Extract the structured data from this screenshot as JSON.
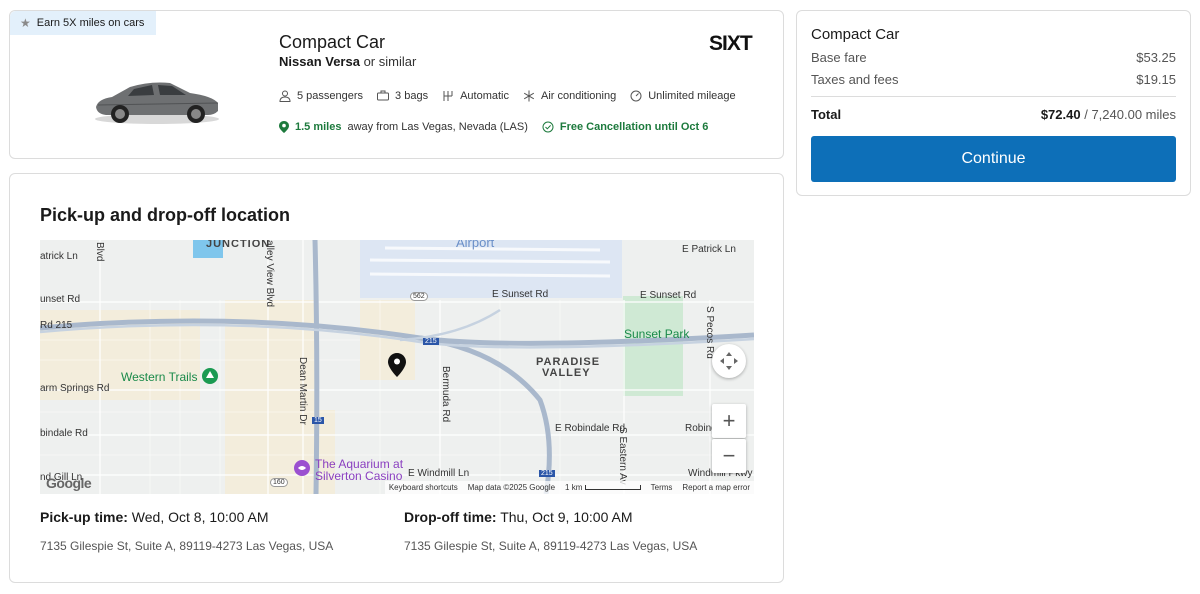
{
  "badge": {
    "text": "Earn 5X miles on cars"
  },
  "car": {
    "title": "Compact Car",
    "model": "Nissan Versa",
    "model_suffix": "or similar",
    "vendor_logo": "SIXT",
    "features": [
      {
        "icon": "person-icon",
        "label": "5 passengers"
      },
      {
        "icon": "bag-icon",
        "label": "3 bags"
      },
      {
        "icon": "transmission-icon",
        "label": "Automatic"
      },
      {
        "icon": "snowflake-icon",
        "label": "Air conditioning"
      },
      {
        "icon": "speedometer-icon",
        "label": "Unlimited mileage"
      }
    ],
    "distance": "1.5 miles",
    "distance_text": "away from Las Vegas, Nevada (LAS)",
    "cancellation": "Free Cancellation until Oct 6"
  },
  "summary": {
    "title": "Compact Car",
    "base_fare_label": "Base fare",
    "base_fare": "$53.25",
    "taxes_label": "Taxes and fees",
    "taxes": "$19.15",
    "total_label": "Total",
    "total": "$72.40",
    "total_miles": "/ 7,240.00 miles",
    "continue_label": "Continue",
    "button_color": "#0d6fb8"
  },
  "location": {
    "heading": "Pick-up and drop-off location",
    "pickup_label": "Pick-up time:",
    "pickup_time": "Wed, Oct 8, 10:00 AM",
    "pickup_address": "7135 Gilespie St, Suite A, 89119-4273 Las Vegas, USA",
    "dropoff_label": "Drop-off time:",
    "dropoff_time": "Thu, Oct 9, 10:00 AM",
    "dropoff_address": "7135 Gilespie St, Suite A, 89119-4273 Las Vegas, USA"
  },
  "map": {
    "labels": {
      "junction": "JUNCTION",
      "airport": "Airport",
      "e_patrick": "E Patrick Ln",
      "patrick": "atrick Ln",
      "e_sunset_1": "E Sunset Rd",
      "e_sunset_2": "E Sunset Rd",
      "sunset": "unset Rd",
      "rd215": "Rd 215",
      "sunset_park": "Sunset Park",
      "paradise": "PARADISE",
      "valley": "VALLEY",
      "western_trails": "Western Trails",
      "warm_springs": "arm Springs Rd",
      "robindale": "bindale Rd",
      "e_robindale": "E Robindale Rd",
      "robind": "Robind",
      "windmill": "nd Gill Ln",
      "e_windmill": "E Windmill Ln",
      "windmill_pkwy": "Windmill Pkwy",
      "aquarium_1": "The Aquarium at",
      "aquarium_2": "Silverton Casino",
      "blvd": "Blvd",
      "valley_view": "alley View Blvd",
      "dean_martin": "Dean Martin Dr",
      "bermuda": "Bermuda Rd",
      "s_pecos": "S Pecos Rd",
      "s_eastern": "S Eastern Av",
      "shield_562": "562",
      "shield_215a": "215",
      "shield_215b": "215",
      "shield_15": "15",
      "shield_160": "160"
    },
    "google": "Google",
    "footer": {
      "shortcuts": "Keyboard shortcuts",
      "data": "Map data ©2025 Google",
      "scale": "1 km",
      "terms": "Terms",
      "report": "Report a map error"
    },
    "zoom_in": "+",
    "zoom_out": "−"
  }
}
